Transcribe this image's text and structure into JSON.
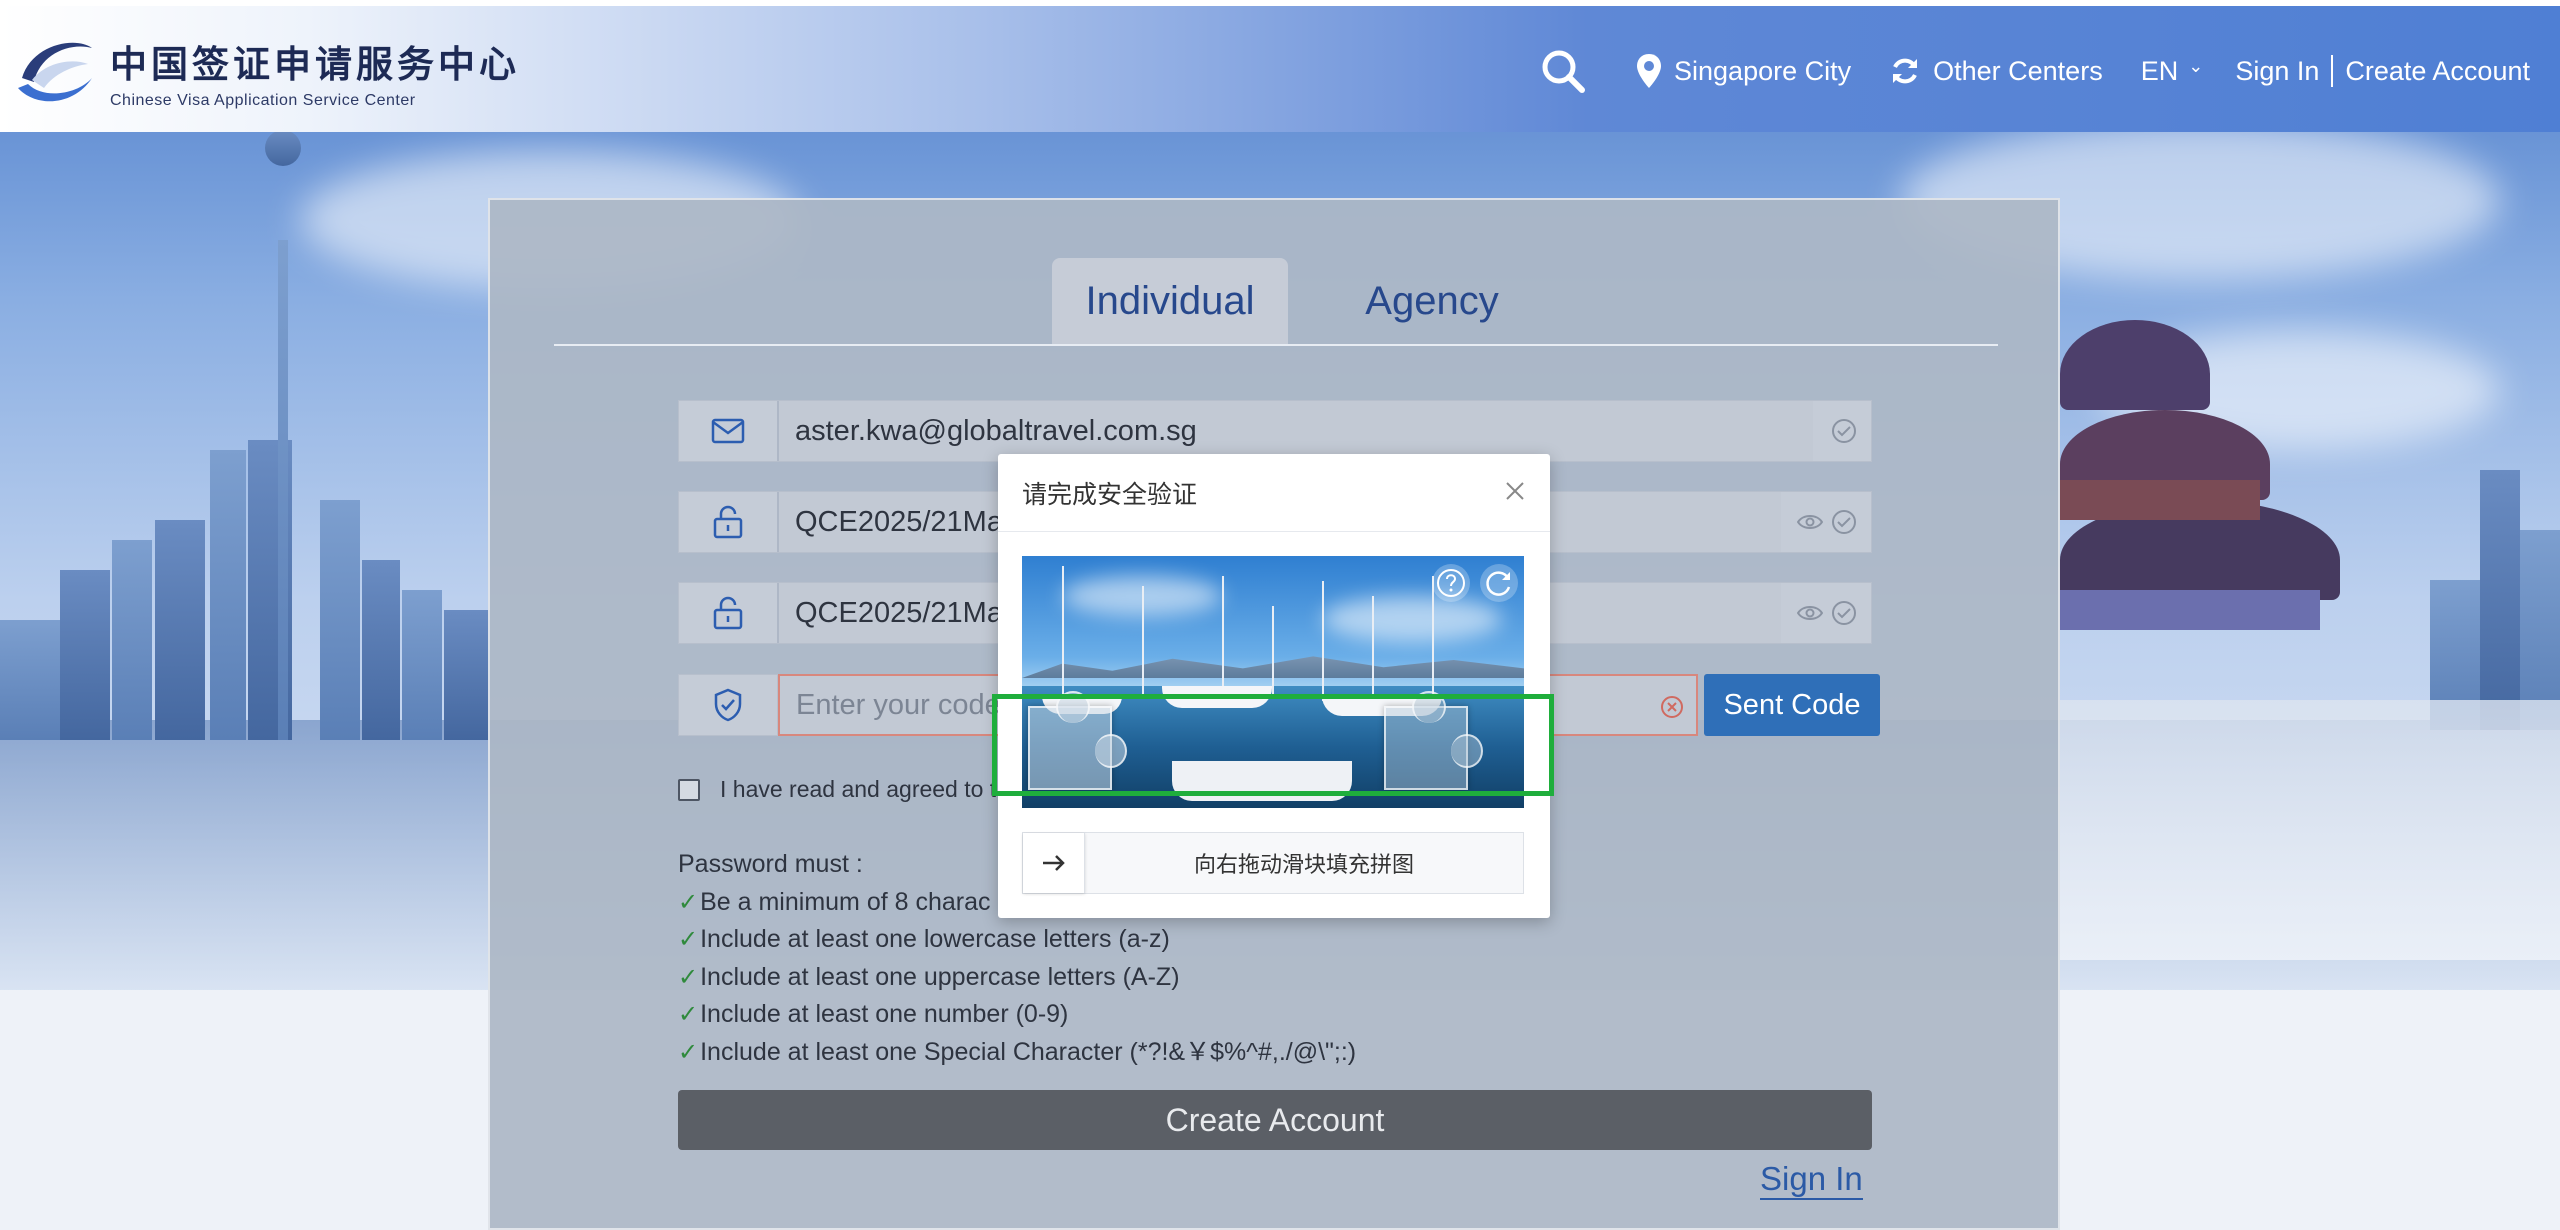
{
  "header": {
    "logo_cn": "中国签证申请服务中心",
    "logo_en": "Chinese Visa Application Service Center",
    "location": "Singapore City",
    "other_centers": "Other Centers",
    "language": "EN",
    "sign_in": "Sign In",
    "create_account": "Create Account"
  },
  "tabs": [
    {
      "label": "Individual",
      "active": true
    },
    {
      "label": "Agency",
      "active": false
    }
  ],
  "form": {
    "email_value": "aster.kwa@globaltravel.com.sg",
    "password_value": "QCE2025/21May",
    "confirm_password_value": "QCE2025/21May",
    "code_placeholder": "Enter your code",
    "sent_code_button": "Sent Code",
    "agree_text": "I have read and agreed to t",
    "create_account_button": "Create Account",
    "sign_in_link": "Sign In"
  },
  "password_rules": {
    "heading": "Password must :",
    "items": [
      "Be a minimum of 8 charac",
      "Include at least one lowercase letters (a-z)",
      "Include at least one uppercase letters (A-Z)",
      "Include at least one number (0-9)",
      "Include at least one Special Character (*?!&￥$%^#,./@\\\";:)"
    ]
  },
  "captcha": {
    "title": "请完成安全验证",
    "slider_hint": "向右拖动滑块填充拼图"
  },
  "colors": {
    "header_blue": "#4f7fd4",
    "tab_text": "#27488c",
    "sent_code_bg": "#2f6fb8",
    "create_btn_bg": "#5b5f66",
    "highlight": "#1fae3c",
    "valid_tick": "#2f8a3c"
  }
}
